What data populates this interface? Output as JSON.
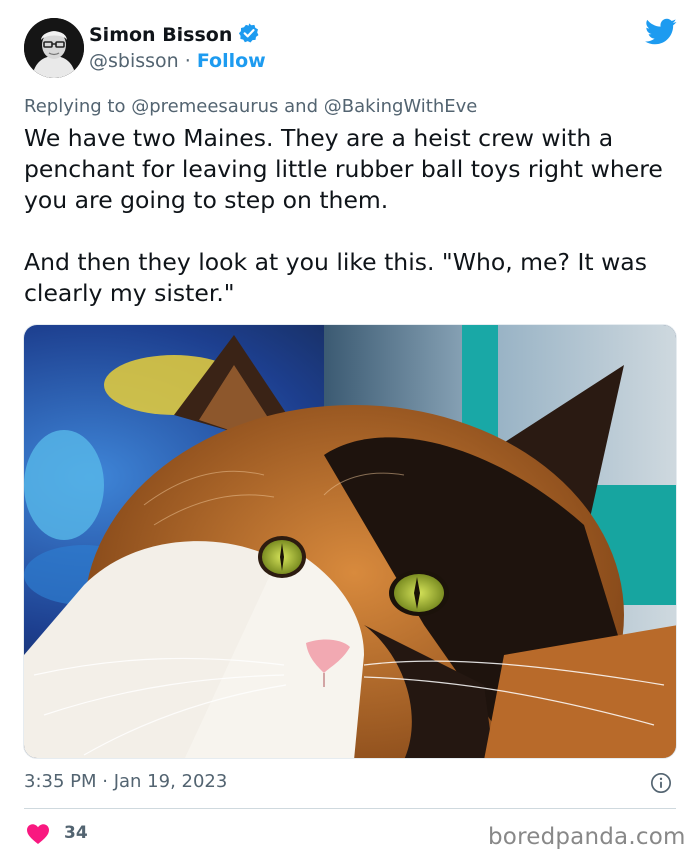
{
  "author": {
    "name": "Simon Bisson",
    "handle": "@sbisson",
    "separator": "·",
    "follow_label": "Follow",
    "verified": true
  },
  "reply": {
    "prefix": "Replying to",
    "mention1": "@premeesaurus",
    "conjunction": "and",
    "mention2": "@BakingWithEve"
  },
  "tweet": {
    "paragraph1": "We have two Maines. They are a heist crew with a penchant for leaving little rubber ball toys right where you are going to step on them.",
    "paragraph2": "And then they look at you like this. \"Who, me? It was clearly my sister.\""
  },
  "media": {
    "icon": "photo-calico-cat"
  },
  "meta": {
    "timestamp": "3:35 PM · Jan 19, 2023"
  },
  "engagement": {
    "likes": "34"
  },
  "watermark": "boredpanda.com",
  "colors": {
    "accent": "#1d9bf0",
    "heart": "#f91880",
    "secondary_text": "#536471"
  }
}
